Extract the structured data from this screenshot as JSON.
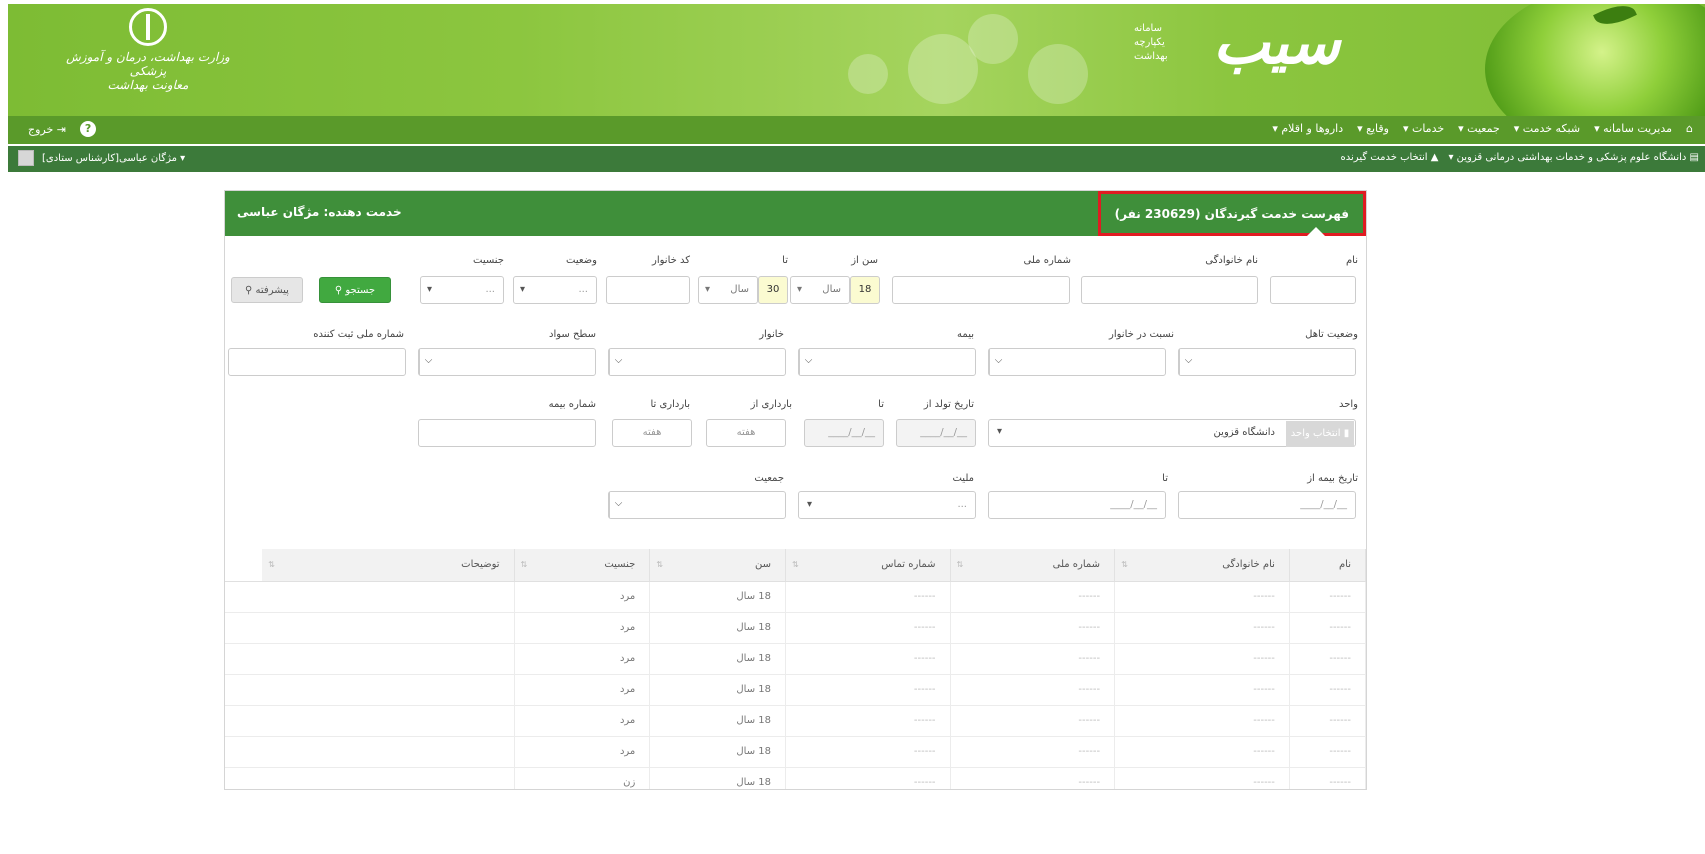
{
  "banner": {
    "ministry_line1": "وزارت بهداشت، درمان و آموزش پزشکی",
    "ministry_line2": "معاونت بهداشت",
    "logo_word": "سیب",
    "logo_tagline": [
      "سامانه",
      "یکپارچه",
      "بهداشت"
    ]
  },
  "menu": {
    "items": [
      "مدیریت سامانه ▾",
      "شبکه خدمت ▾",
      "جمعیت ▾",
      "خدمات ▾",
      "وقایع ▾",
      "داروها و اقلام ▾"
    ],
    "exit_label": "خروج",
    "help_icon": "?"
  },
  "context": {
    "university": "دانشگاه علوم پزشکی و خدمات بهداشتی درمانی قزوین ▾",
    "select_service": "انتخاب خدمت گیرنده",
    "user": "مژگان عباسی[کارشناس ستادی] ▾"
  },
  "panel": {
    "title": "فهرست خدمت گیرندگان (230629 نفر)",
    "provider": "خدمت دهنده: مژگان عباسی"
  },
  "filters": {
    "first_name": "نام",
    "last_name": "نام خانوادگی",
    "national_id": "شماره ملی",
    "age_from": "سن از",
    "age_from_value": "18",
    "age_to": "تا",
    "age_to_value": "30",
    "age_unit": "سال",
    "family_code": "کد خانوار",
    "status": "وضعیت",
    "status_value": "...",
    "gender": "جنسیت",
    "gender_value": "...",
    "search_btn": "جستجو",
    "advanced_btn": "پیشرفته",
    "marital_status": "وضعیت تاهل",
    "relation": "نسبت در خانوار",
    "insurance": "بیمه",
    "household": "خانوار",
    "literacy": "سطح سواد",
    "registrar_id": "شماره ملی ثبت کننده",
    "unit": "واحد",
    "unit_btn": "انتخاب واحد",
    "unit_value": "دانشگاه قزوین",
    "birth_from": "تاریخ تولد از",
    "birth_to": "تا",
    "date_placeholder": "__/__/____",
    "preg_from": "بارداری از",
    "preg_to": "بارداری تا",
    "week_placeholder": "هفته",
    "insurance_no": "شماره بیمه",
    "ins_date_from": "تاریخ بیمه از",
    "ins_date_to": "تا",
    "nationality": "ملیت",
    "nationality_value": "...",
    "population": "جمعیت"
  },
  "table": {
    "headers": [
      "نام",
      "نام خانوادگی",
      "شماره ملی",
      "شماره تماس",
      "سن",
      "جنسیت",
      "توضیحات"
    ],
    "rows": [
      [
        "------",
        "------",
        "------",
        "------",
        "18 سال",
        "مرد",
        ""
      ],
      [
        "------",
        "------",
        "------",
        "------",
        "18 سال",
        "مرد",
        ""
      ],
      [
        "------",
        "------",
        "------",
        "------",
        "18 سال",
        "مرد",
        ""
      ],
      [
        "------",
        "------",
        "------",
        "------",
        "18 سال",
        "مرد",
        ""
      ],
      [
        "------",
        "------",
        "------",
        "------",
        "18 سال",
        "مرد",
        ""
      ],
      [
        "------",
        "------",
        "------",
        "------",
        "18 سال",
        "مرد",
        ""
      ],
      [
        "------",
        "------",
        "------",
        "------",
        "18 سال",
        "زن",
        ""
      ]
    ]
  },
  "colors": {
    "banner_green": "#8cc63f",
    "menu_green": "#5a9a2a",
    "context_green": "#3c7a3a",
    "panel_header": "#3f8f3a",
    "highlight_red": "#e01b22",
    "search_button": "#41a940",
    "age_field_bg": "#fbfbd1"
  }
}
